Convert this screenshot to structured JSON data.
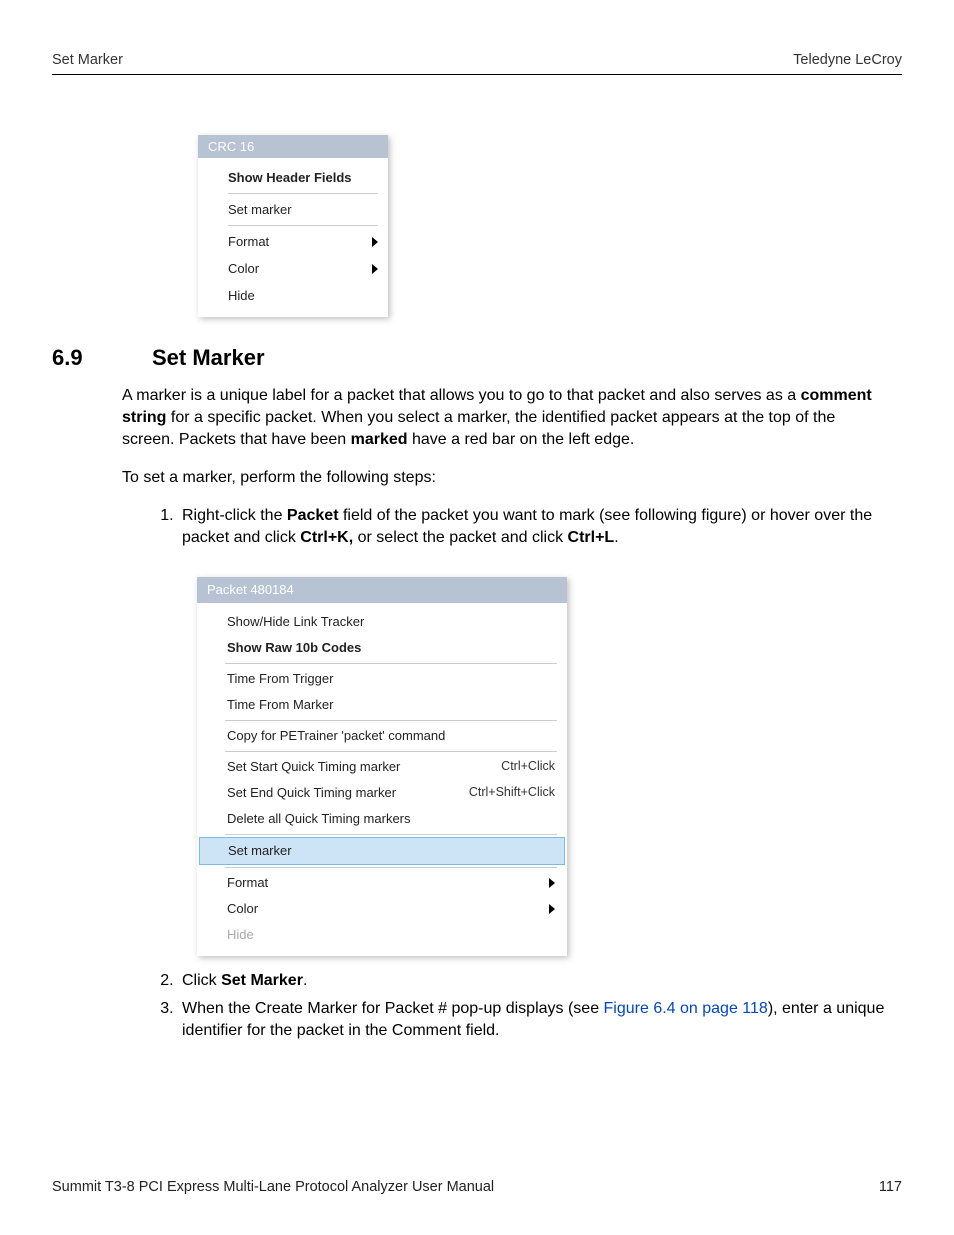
{
  "header": {
    "left": "Set Marker",
    "right": "Teledyne LeCroy"
  },
  "menu1": {
    "title": "CRC 16",
    "items": [
      {
        "label": "Show Header Fields",
        "bold": true
      },
      {
        "divider": true
      },
      {
        "label": "Set marker"
      },
      {
        "divider": true
      },
      {
        "label": "Format",
        "arrow": true
      },
      {
        "label": "Color",
        "arrow": true
      },
      {
        "label": "Hide"
      }
    ]
  },
  "section": {
    "num": "6.9",
    "title": "Set Marker"
  },
  "para1_a": "A marker is a unique label for a packet that allows you to go to that packet and also serves as a ",
  "para1_b": "comment string",
  "para1_c": " for a specific packet. When you select a marker, the identified packet appears at the top of the screen. Packets that have been ",
  "para1_d": "marked",
  "para1_e": " have a red bar on the left edge.",
  "para2": "To set a marker, perform the following steps:",
  "step1_a": "Right-click the ",
  "step1_b": "Packet",
  "step1_c": " field of the packet you want to mark (see following figure) or hover over the packet and click ",
  "step1_d": "Ctrl+K,",
  "step1_e": " or select the packet and click ",
  "step1_f": "Ctrl+L",
  "step1_g": ".",
  "menu2": {
    "title": "Packet 480184",
    "g1": [
      "Show/Hide Link Tracker",
      "Show Raw 10b Codes"
    ],
    "g2": [
      "Time From Trigger",
      "Time From Marker"
    ],
    "g3": [
      "Copy for PETrainer 'packet' command"
    ],
    "g4": [
      {
        "label": "Set Start Quick Timing marker",
        "shortcut": "Ctrl+Click"
      },
      {
        "label": "Set End Quick Timing marker",
        "shortcut": "Ctrl+Shift+Click"
      },
      {
        "label": "Delete all Quick Timing markers"
      }
    ],
    "sel": "Set marker",
    "g5": [
      {
        "label": "Format",
        "arrow": true
      },
      {
        "label": "Color",
        "arrow": true
      },
      {
        "label": "Hide",
        "disabled": true
      }
    ]
  },
  "step2_a": "Click ",
  "step2_b": "Set Marker",
  "step2_c": ".",
  "step3_a": "When the Create Marker for Packet # pop-up displays (see ",
  "step3_link": "Figure 6.4 on page 118",
  "step3_b": "), enter a unique identifier for the packet in the Comment field.",
  "footer": {
    "left": "Summit T3-8 PCI Express Multi-Lane Protocol Analyzer User Manual",
    "page": "117"
  }
}
